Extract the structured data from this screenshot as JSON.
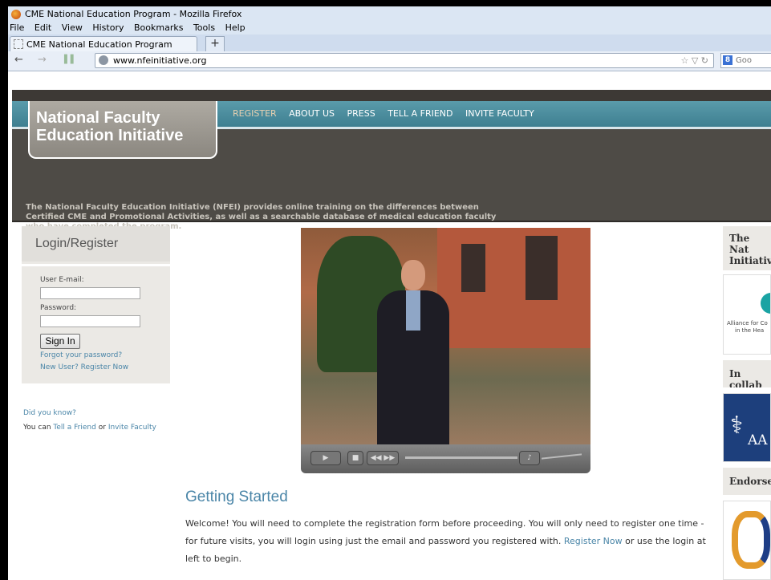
{
  "browser": {
    "window_title": "CME National Education Program - Mozilla Firefox",
    "menu": [
      "File",
      "Edit",
      "View",
      "History",
      "Bookmarks",
      "Tools",
      "Help"
    ],
    "tab_title": "CME National Education Program",
    "new_tab": "+",
    "url": "www.nfeinitiative.org",
    "search_placeholder": "Goo"
  },
  "site": {
    "logo_line1": "National Faculty",
    "logo_line2": "Education Initiative",
    "nav": [
      "REGISTER",
      "ABOUT US",
      "PRESS",
      "TELL A FRIEND",
      "INVITE FACULTY"
    ],
    "intro": "The National Faculty Education Initiative (NFEI) provides online training on the differences between Certified CME and Promotional Activities, as well as a searchable database of medical education faculty who have completed the program."
  },
  "login": {
    "title": "Login/Register",
    "email_label": "User E-mail:",
    "password_label": "Password:",
    "sign_in": "Sign In",
    "forgot": "Forgot your password?",
    "new_user": "New User? Register Now"
  },
  "sidebar": {
    "did_you_know": "Did you know?",
    "you_can": "You can",
    "tell_friend": "Tell a Friend",
    "or": "or",
    "invite_faculty": "Invite Faculty"
  },
  "main": {
    "heading": "Getting Started",
    "welcome_1": "Welcome! You will need to complete the registration form before proceeding. You will only need to register one time - for future visits, you will login using just the email and password you registered with.",
    "register_now": "Register Now",
    "welcome_2": "or use the login at left to begin."
  },
  "right": {
    "box1_line1": "The Nat",
    "box1_line2": "Initiativ",
    "alliance_line1": "Alliance for Co",
    "alliance_line2": "in the Hea",
    "collab": "In collab",
    "aa_text": "AA",
    "endorse": "Endorse"
  }
}
